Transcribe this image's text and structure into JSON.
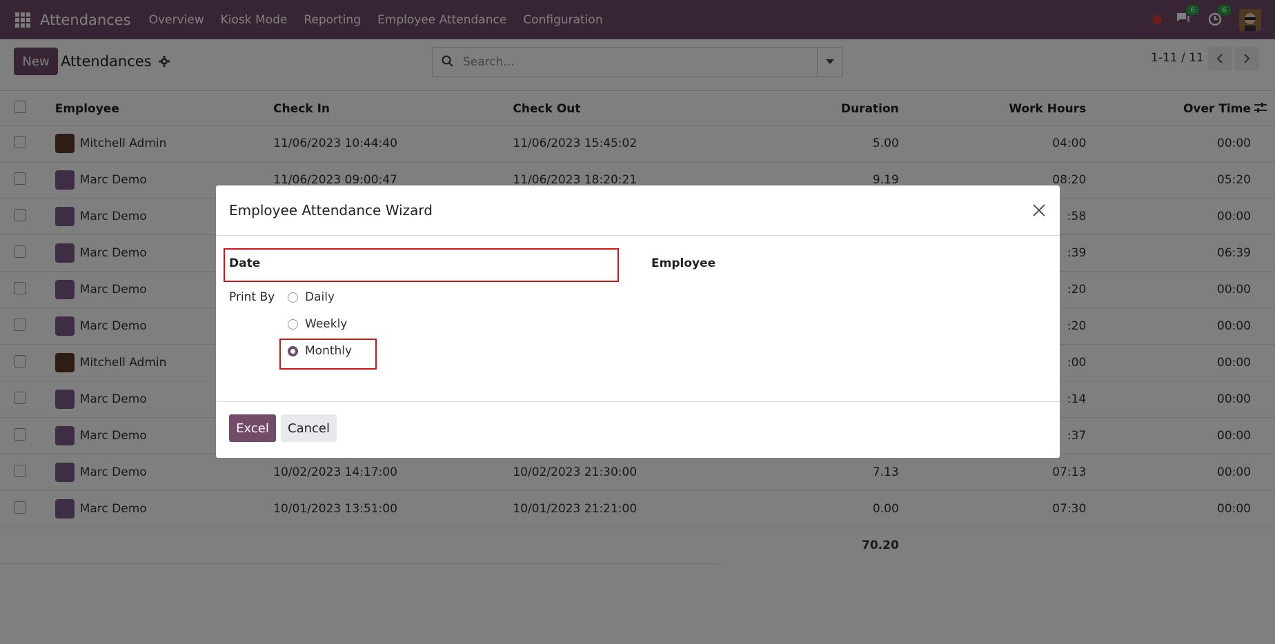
{
  "navbar": {
    "app_name": "Attendances",
    "items": [
      "Overview",
      "Kiosk Mode",
      "Reporting",
      "Employee Attendance",
      "Configuration"
    ],
    "messages_badge": "6",
    "activities_badge": "6"
  },
  "control_panel": {
    "new_label": "New",
    "breadcrumb": "Attendances",
    "search_placeholder": "Search...",
    "pager": "1-11 / 11"
  },
  "table": {
    "headers": {
      "employee": "Employee",
      "check_in": "Check In",
      "check_out": "Check Out",
      "duration": "Duration",
      "work_hours": "Work Hours",
      "over_time": "Over Time"
    },
    "rows": [
      {
        "employee": "Mitchell Admin",
        "check_in": "11/06/2023 10:44:40",
        "check_out": "11/06/2023 15:45:02",
        "duration": "5.00",
        "work_hours": "04:00",
        "over_time": "00:00"
      },
      {
        "employee": "Marc Demo",
        "check_in": "11/06/2023 09:00:47",
        "check_out": "11/06/2023 18:20:21",
        "duration": "9.19",
        "work_hours": "08:20",
        "over_time": "05:20"
      },
      {
        "employee": "Marc Demo",
        "check_in": "",
        "check_out": "",
        "duration": "",
        "work_hours": ":58",
        "over_time": "00:00"
      },
      {
        "employee": "Marc Demo",
        "check_in": "",
        "check_out": "",
        "duration": "",
        "work_hours": ":39",
        "over_time": "06:39"
      },
      {
        "employee": "Marc Demo",
        "check_in": "",
        "check_out": "",
        "duration": "",
        "work_hours": ":20",
        "over_time": "00:00"
      },
      {
        "employee": "Marc Demo",
        "check_in": "",
        "check_out": "",
        "duration": "",
        "work_hours": ":20",
        "over_time": "00:00"
      },
      {
        "employee": "Mitchell Admin",
        "check_in": "",
        "check_out": "",
        "duration": "",
        "work_hours": ":00",
        "over_time": "00:00"
      },
      {
        "employee": "Marc Demo",
        "check_in": "",
        "check_out": "",
        "duration": "",
        "work_hours": ":14",
        "over_time": "00:00"
      },
      {
        "employee": "Marc Demo",
        "check_in": "",
        "check_out": "",
        "duration": "",
        "work_hours": ":37",
        "over_time": "00:00"
      },
      {
        "employee": "Marc Demo",
        "check_in": "10/02/2023 14:17:00",
        "check_out": "10/02/2023 21:30:00",
        "duration": "7.13",
        "work_hours": "07:13",
        "over_time": "00:00"
      },
      {
        "employee": "Marc Demo",
        "check_in": "10/01/2023 13:51:00",
        "check_out": "10/01/2023 21:21:00",
        "duration": "0.00",
        "work_hours": "07:30",
        "over_time": "00:00"
      }
    ],
    "total_duration": "70.20"
  },
  "modal": {
    "title": "Employee Attendance Wizard",
    "date_label": "Date",
    "employee_label": "Employee",
    "print_by_label": "Print By",
    "options": [
      "Daily",
      "Weekly",
      "Monthly"
    ],
    "selected": "Monthly",
    "excel_label": "Excel",
    "cancel_label": "Cancel"
  }
}
